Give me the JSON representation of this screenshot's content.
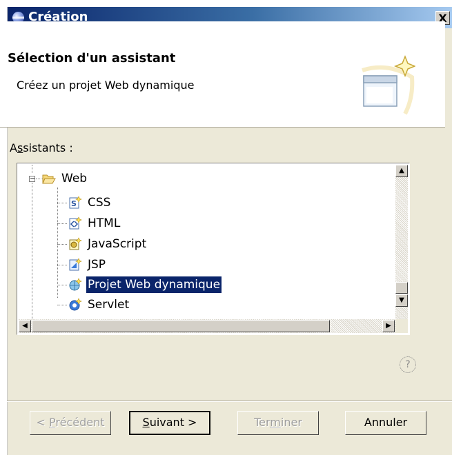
{
  "window": {
    "title": "Création",
    "close_label": "X"
  },
  "header": {
    "title": "Sélection d'un assistant",
    "description": "Créez un projet Web dynamique"
  },
  "assistants": {
    "label_prefix": "A",
    "label_mnemonic": "s",
    "label_rest": "sistants :",
    "folder": {
      "label": "Web",
      "expander": "−"
    },
    "items": [
      {
        "label": "CSS",
        "icon": "css-file-icon"
      },
      {
        "label": "HTML",
        "icon": "html-file-icon"
      },
      {
        "label": "JavaScript",
        "icon": "javascript-file-icon"
      },
      {
        "label": "JSP",
        "icon": "jsp-file-icon"
      },
      {
        "label": "Projet Web dynamique",
        "icon": "dynamic-web-project-icon",
        "selected": true
      },
      {
        "label": "Servlet",
        "icon": "servlet-icon"
      }
    ]
  },
  "help_glyph": "?",
  "buttons": {
    "back": {
      "before": "< ",
      "mnemonic": "P",
      "after": "récédent"
    },
    "next": {
      "mnemonic": "S",
      "after": "uivant >"
    },
    "finish": {
      "before": "Ter",
      "mnemonic": "m",
      "after": "iner"
    },
    "cancel": "Annuler"
  },
  "colors": {
    "titlebar": "#0a246a",
    "selection": "#0a246a",
    "dialog_bg": "#ece9d8"
  }
}
